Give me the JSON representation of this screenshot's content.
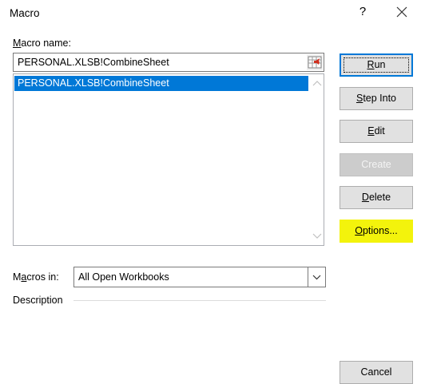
{
  "window": {
    "title": "Macro",
    "help_glyph": "?"
  },
  "macro_name": {
    "label_u": "M",
    "label_rest": "acro name:",
    "value": "PERSONAL.XLSB!CombineSheet"
  },
  "macro_list": {
    "items": [
      "PERSONAL.XLSB!CombineSheet"
    ],
    "selected_index": 0
  },
  "buttons": {
    "run": {
      "u": "R",
      "rest": "un"
    },
    "step_into": {
      "u": "S",
      "rest": "tep Into"
    },
    "edit": {
      "u": "E",
      "rest": "dit"
    },
    "create": {
      "label": "Create"
    },
    "delete": {
      "u": "D",
      "rest": "elete"
    },
    "options": {
      "u": "O",
      "rest": "ptions..."
    },
    "cancel": {
      "label": "Cancel"
    }
  },
  "macros_in": {
    "label_pre": "M",
    "label_u": "a",
    "label_rest": "cros in:",
    "selected": "All Open Workbooks"
  },
  "description": {
    "label": "Description"
  },
  "colors": {
    "selection": "#0078d7",
    "highlight": "#f3f30c"
  }
}
